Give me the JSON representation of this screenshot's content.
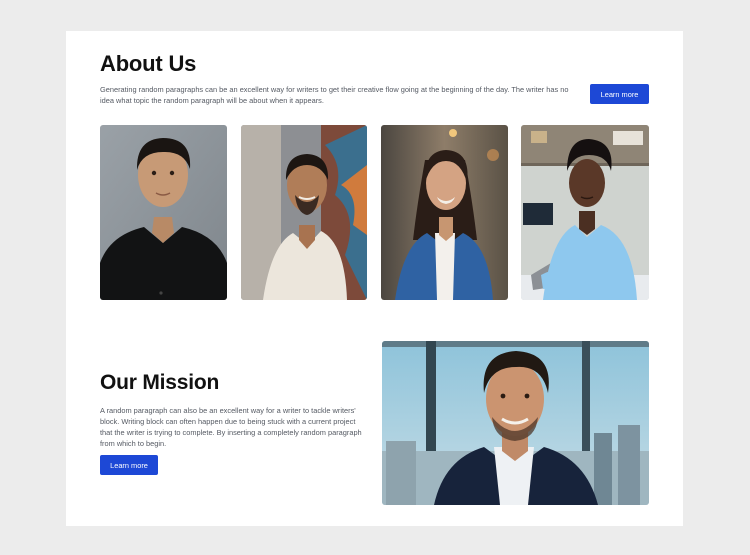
{
  "about": {
    "title": "About Us",
    "description": "Generating random paragraphs can be an excellent way for writers to get their creative flow going at the beginning of the day. The writer has no idea what topic the random paragraph will be about when it appears.",
    "button_label": "Learn more"
  },
  "team": {
    "photos": [
      {
        "name": "portrait-man-black-shirt"
      },
      {
        "name": "portrait-man-white-shirt"
      },
      {
        "name": "portrait-woman-denim-jacket"
      },
      {
        "name": "portrait-woman-blue-shirt"
      }
    ]
  },
  "mission": {
    "title": "Our Mission",
    "description": "A random paragraph can also be an excellent way for a writer to tackle writers' block. Writing block can often happen due to being stuck with a current project that the writer is trying to complete. By inserting a completely random paragraph from which to begin.",
    "button_label": "Learn more"
  },
  "colors": {
    "page_background": "#ececec",
    "card_background": "#ffffff",
    "accent": "#1d48d6",
    "heading": "#111111",
    "body_text": "#555a63"
  }
}
